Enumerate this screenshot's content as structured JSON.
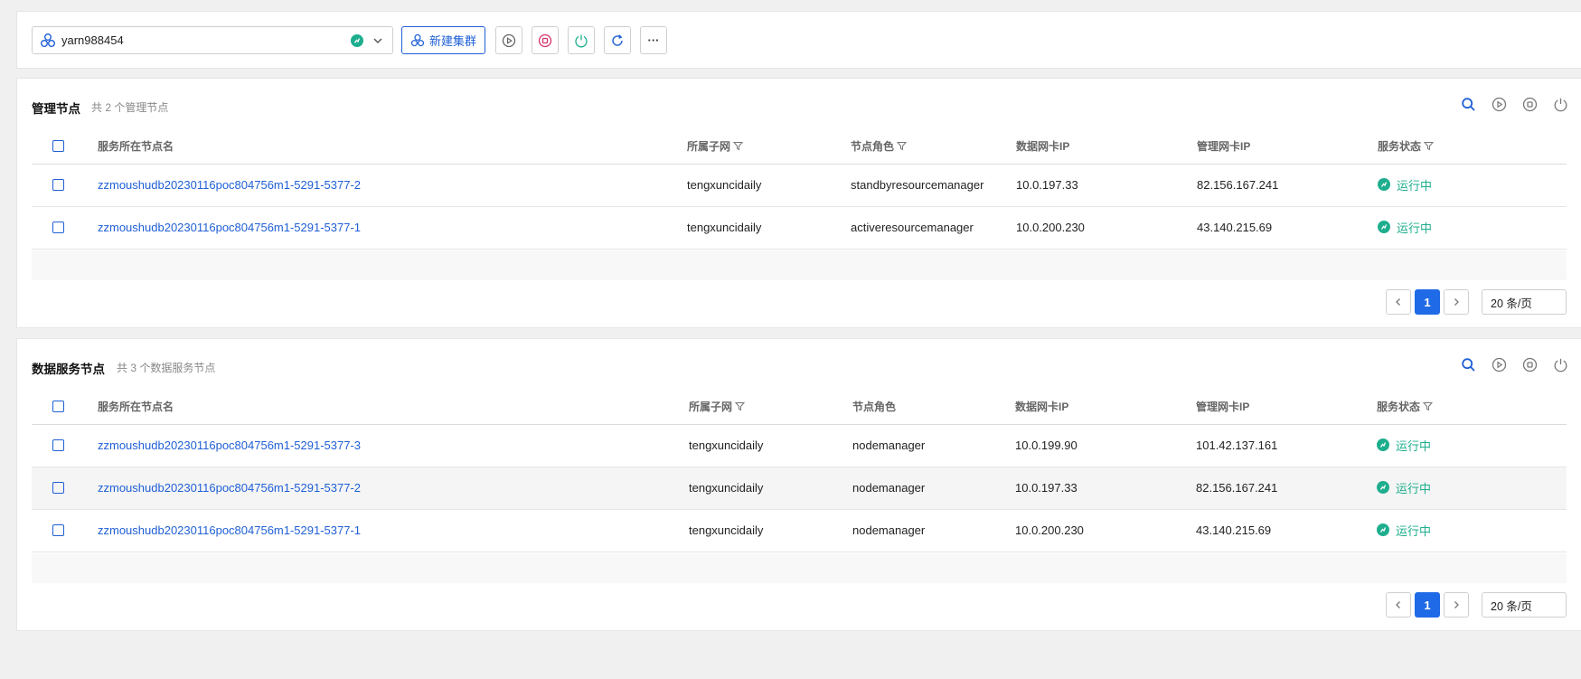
{
  "toolbar": {
    "cluster_name": "yarn988454",
    "new_cluster_label": "新建集群",
    "more_label": "···"
  },
  "colors": {
    "accent": "#1f5fd6",
    "running": "#1eae8e",
    "stop": "#d6336c",
    "power": "#1eae8e"
  },
  "mgmt": {
    "title": "管理节点",
    "subtitle": "共 2 个管理节点",
    "columns": [
      "服务所在节点名",
      "所属子网",
      "节点角色",
      "数据网卡IP",
      "管理网卡IP",
      "服务状态"
    ],
    "rows": [
      {
        "name": "zzmoushudb20230116poc804756m1-5291-5377-2",
        "subnet": "tengxuncidaily",
        "role": "standbyresourcemanager",
        "data_ip": "10.0.197.33",
        "mgmt_ip": "82.156.167.241",
        "status": "运行中"
      },
      {
        "name": "zzmoushudb20230116poc804756m1-5291-5377-1",
        "subnet": "tengxuncidaily",
        "role": "activeresourcemanager",
        "data_ip": "10.0.200.230",
        "mgmt_ip": "43.140.215.69",
        "status": "运行中"
      }
    ],
    "page": "1",
    "page_size": "20 条/页"
  },
  "data": {
    "title": "数据服务节点",
    "subtitle": "共 3 个数据服务节点",
    "columns": [
      "服务所在节点名",
      "所属子网",
      "节点角色",
      "数据网卡IP",
      "管理网卡IP",
      "服务状态"
    ],
    "rows": [
      {
        "name": "zzmoushudb20230116poc804756m1-5291-5377-3",
        "subnet": "tengxuncidaily",
        "role": "nodemanager",
        "data_ip": "10.0.199.90",
        "mgmt_ip": "101.42.137.161",
        "status": "运行中"
      },
      {
        "name": "zzmoushudb20230116poc804756m1-5291-5377-2",
        "subnet": "tengxuncidaily",
        "role": "nodemanager",
        "data_ip": "10.0.197.33",
        "mgmt_ip": "82.156.167.241",
        "status": "运行中"
      },
      {
        "name": "zzmoushudb20230116poc804756m1-5291-5377-1",
        "subnet": "tengxuncidaily",
        "role": "nodemanager",
        "data_ip": "10.0.200.230",
        "mgmt_ip": "43.140.215.69",
        "status": "运行中"
      }
    ],
    "page": "1",
    "page_size": "20 条/页"
  }
}
